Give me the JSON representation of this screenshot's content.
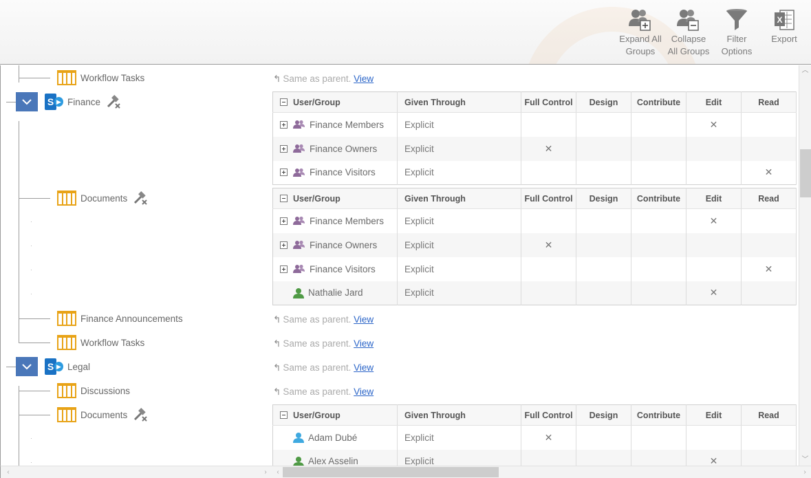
{
  "toolbar": {
    "expand_all": [
      "Expand All",
      "Groups"
    ],
    "collapse_all": [
      "Collapse",
      "All Groups"
    ],
    "filter": [
      "Filter",
      "Options"
    ],
    "export": [
      "Export"
    ]
  },
  "colors": {
    "accent": "#4a77b9",
    "list_icon": "#e8a317",
    "link": "#2b65c8",
    "sharepoint": "#1a72c4"
  },
  "same_as_parent": {
    "text": "Same as parent.",
    "link": "View"
  },
  "headers": {
    "user_group": "User/Group",
    "given_through": "Given Through",
    "perms": [
      "Full Control",
      "Design",
      "Contribute",
      "Edit",
      "Read"
    ]
  },
  "tree": {
    "workflow_tasks_1": "Workflow Tasks",
    "finance": "Finance",
    "documents_1": "Documents",
    "finance_announcements": "Finance Announcements",
    "workflow_tasks_2": "Workflow Tasks",
    "legal": "Legal",
    "discussions": "Discussions",
    "documents_2": "Documents"
  },
  "tables": {
    "finance": [
      {
        "name": "Finance Members",
        "given": "Explicit",
        "type": "group",
        "perm": "Edit"
      },
      {
        "name": "Finance Owners",
        "given": "Explicit",
        "type": "group",
        "perm": "Full Control"
      },
      {
        "name": "Finance Visitors",
        "given": "Explicit",
        "type": "group",
        "perm": "Read"
      }
    ],
    "finance_documents": [
      {
        "name": "Finance Members",
        "given": "Explicit",
        "type": "group",
        "perm": "Edit"
      },
      {
        "name": "Finance Owners",
        "given": "Explicit",
        "type": "group",
        "perm": "Full Control"
      },
      {
        "name": "Finance Visitors",
        "given": "Explicit",
        "type": "group",
        "perm": "Read"
      },
      {
        "name": "Nathalie Jard",
        "given": "Explicit",
        "type": "user",
        "perm": "Edit"
      }
    ],
    "legal_documents": [
      {
        "name": "Adam Dubé",
        "given": "Explicit",
        "type": "user-blue",
        "perm": "Full Control"
      },
      {
        "name": "Alex Asselin",
        "given": "Explicit",
        "type": "user",
        "perm": "Edit"
      }
    ]
  }
}
